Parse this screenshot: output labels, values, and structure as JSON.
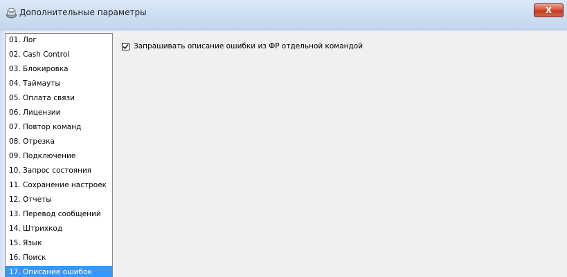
{
  "window": {
    "title": "Дополнительные параметры",
    "close_label": "X"
  },
  "sidebar": {
    "items": [
      {
        "label": "01. Лог"
      },
      {
        "label": "02. Cash Control"
      },
      {
        "label": "03. Блокировка"
      },
      {
        "label": "04. Таймауты"
      },
      {
        "label": "05. Оплата связи"
      },
      {
        "label": "06. Лицензии"
      },
      {
        "label": "07. Повтор команд"
      },
      {
        "label": "08. Отрезка"
      },
      {
        "label": "09. Подключение"
      },
      {
        "label": "10. Запрос состояния"
      },
      {
        "label": "11. Сохранение настроек"
      },
      {
        "label": "12. Отчеты"
      },
      {
        "label": "13. Перевод сообщений"
      },
      {
        "label": "14. Штрихкод"
      },
      {
        "label": "15. Язык"
      },
      {
        "label": "16. Поиск"
      },
      {
        "label": "17. Описание ошибок"
      }
    ],
    "selected_index": 16
  },
  "main": {
    "option_label": "Запрашивать описание ошибки из ФР отдельной командой",
    "option_checked": true
  },
  "colors": {
    "selection": "#3399ff",
    "close_button": "#c23a22"
  }
}
